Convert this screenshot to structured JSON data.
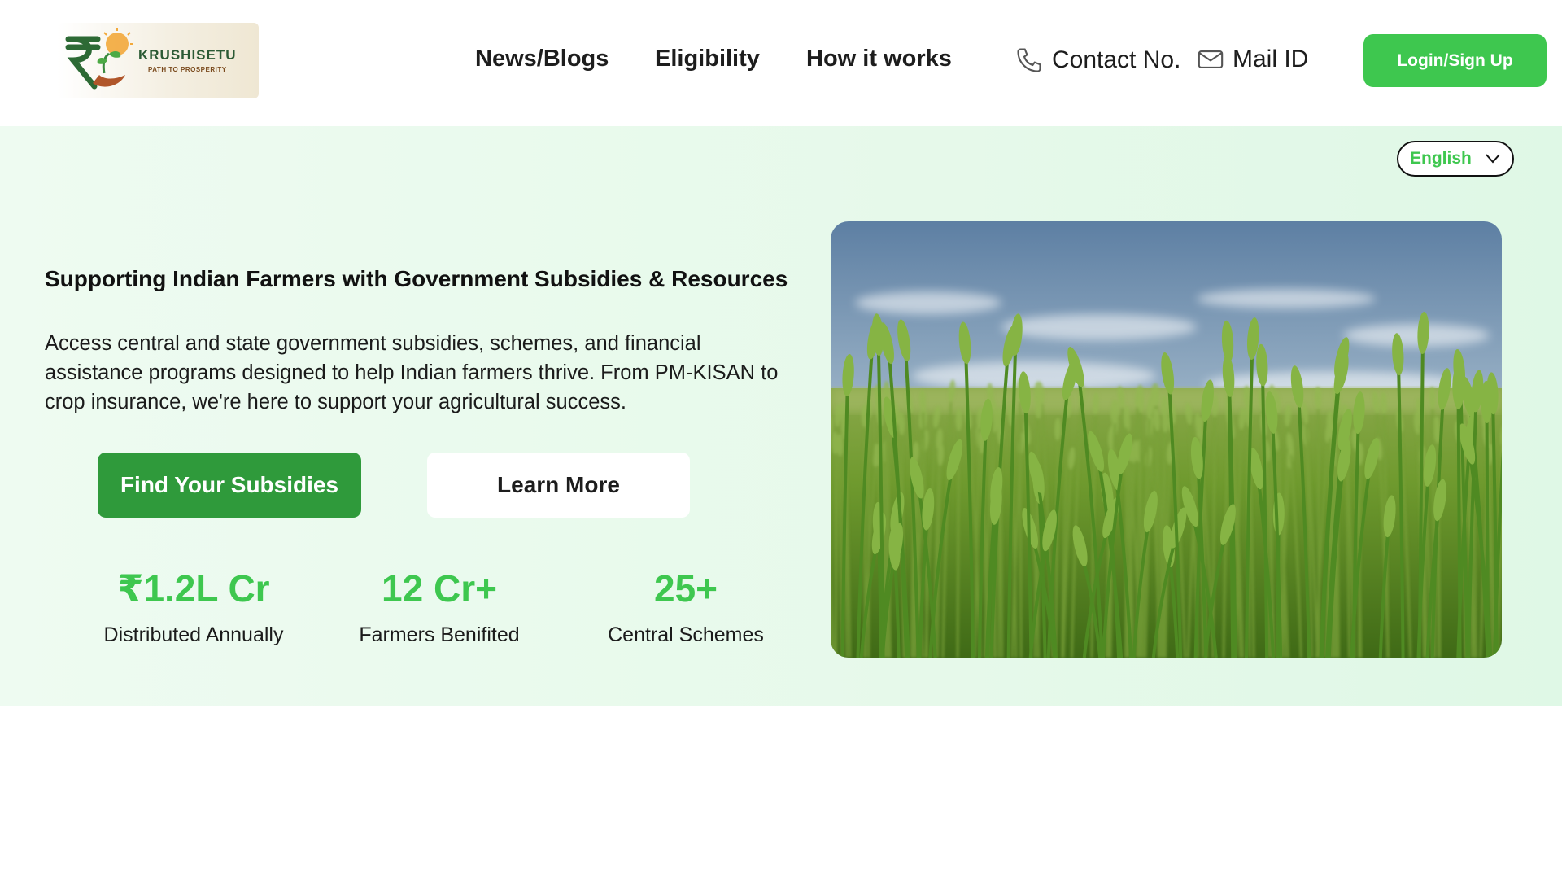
{
  "header": {
    "logo": {
      "name": "KRUSHISETU",
      "tagline": "PATH TO PROSPERITY"
    },
    "nav": [
      {
        "label": "News/Blogs"
      },
      {
        "label": "Eligibility"
      },
      {
        "label": "How it works"
      }
    ],
    "contact": {
      "phone_label": "Contact No.",
      "mail_label": "Mail ID"
    },
    "login_label": "Login/Sign Up"
  },
  "hero": {
    "language": {
      "selected": "English"
    },
    "title": "Supporting Indian Farmers with Government Subsidies & Resources",
    "description": "Access central and state government subsidies, schemes, and financial assistance programs designed to help Indian farmers thrive. From PM-KISAN to crop insurance, we're here to support your agricultural success.",
    "primary_button": "Find Your Subsidies",
    "secondary_button": "Learn More",
    "stats": [
      {
        "value": "₹1.2L Cr",
        "label": "Distributed Annually"
      },
      {
        "value": "12 Cr+",
        "label": "Farmers Benifited"
      },
      {
        "value": "25+",
        "label": "Central Schemes"
      }
    ]
  },
  "colors": {
    "accent_green": "#3ec74f",
    "dark_green": "#2f9a3b",
    "hero_background": "#e6f9ea"
  },
  "icons": [
    "logo-rupee-plant-icon",
    "phone-icon",
    "mail-icon",
    "chevron-down-icon",
    "wheat-field-image"
  ]
}
